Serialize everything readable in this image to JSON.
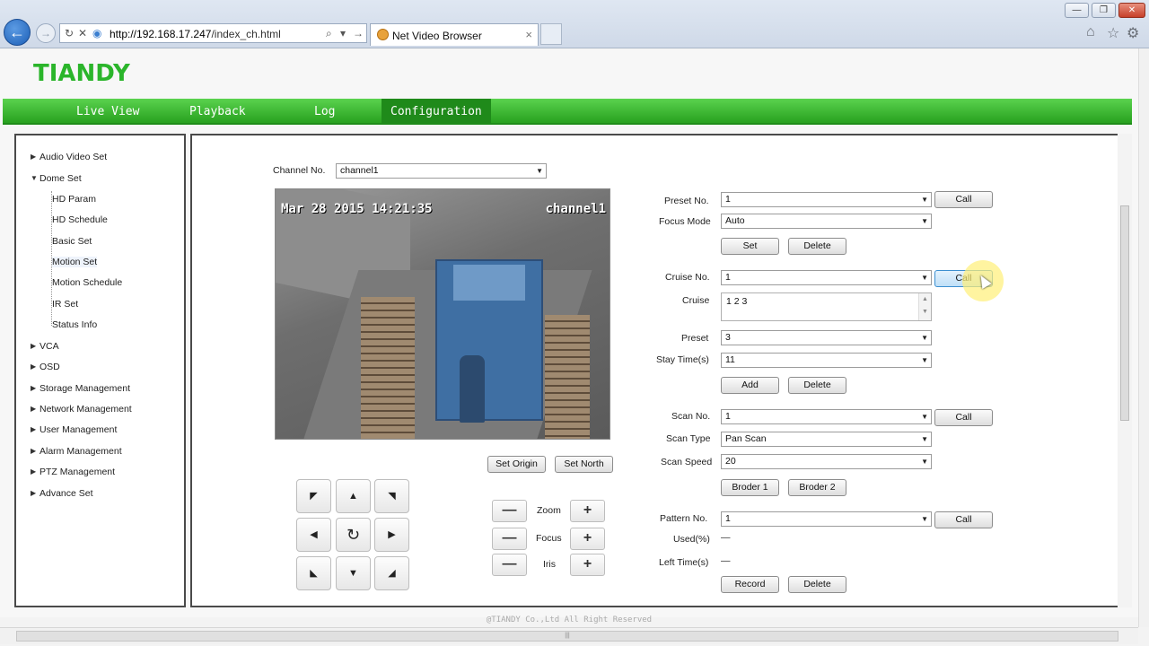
{
  "browser": {
    "url_host": "http://192.168.17.247",
    "url_path": "/index_ch.html",
    "tab_title": "Net Video Browser",
    "tab_close": "×",
    "back_icon": "arrow-left-icon",
    "forward_icon": "arrow-right-icon"
  },
  "app": {
    "logo": "TIANDY",
    "menu": [
      "Live View",
      "Playback",
      "Log",
      "Configuration"
    ],
    "active_menu": "Configuration"
  },
  "sidebar": {
    "items": [
      {
        "label": "Audio Video Set",
        "expanded": false
      },
      {
        "label": "Dome Set",
        "expanded": true
      },
      {
        "label": "HD Param"
      },
      {
        "label": "HD Schedule"
      },
      {
        "label": "Basic Set"
      },
      {
        "label": "Motion Set",
        "selected": true
      },
      {
        "label": "Motion Schedule"
      },
      {
        "label": "IR Set"
      },
      {
        "label": "Status Info"
      },
      {
        "label": "VCA",
        "expanded": false
      },
      {
        "label": "OSD",
        "expanded": false
      },
      {
        "label": "Storage Management",
        "expanded": false
      },
      {
        "label": "Network Management",
        "expanded": false
      },
      {
        "label": "User Management",
        "expanded": false
      },
      {
        "label": "Alarm Management",
        "expanded": false
      },
      {
        "label": "PTZ Management",
        "expanded": false
      },
      {
        "label": "Advance Set",
        "expanded": false
      }
    ]
  },
  "main": {
    "channel_label": "Channel No.",
    "channel_value": "channel1",
    "video": {
      "timestamp": "Mar 28 2015 14:21:35",
      "channel_overlay": "channel1"
    },
    "set_origin": "Set Origin",
    "set_north": "Set North",
    "zoom_label": "Zoom",
    "focus_label": "Focus",
    "iris_label": "Iris",
    "minus": "—",
    "plus": "+",
    "preset": {
      "label": "Preset No.",
      "value": "1",
      "call": "Call",
      "focus_mode_label": "Focus Mode",
      "focus_mode_value": "Auto",
      "set": "Set",
      "delete": "Delete"
    },
    "cruise": {
      "label": "Cruise No.",
      "value": "1",
      "call": "Call",
      "cruise_label": "Cruise",
      "cruise_value": "1 2 3",
      "preset_label": "Preset",
      "preset_value": "3",
      "stay_label": "Stay Time(s)",
      "stay_value": "11",
      "add": "Add",
      "delete": "Delete"
    },
    "scan": {
      "label": "Scan No.",
      "value": "1",
      "call": "Call",
      "type_label": "Scan Type",
      "type_value": "Pan Scan",
      "speed_label": "Scan Speed",
      "speed_value": "20",
      "broder1": "Broder 1",
      "broder2": "Broder 2"
    },
    "pattern": {
      "label": "Pattern No.",
      "value": "1",
      "call": "Call",
      "used_label": "Used(%)",
      "used_value": "—",
      "left_label": "Left Time(s)",
      "left_value": "—",
      "record": "Record",
      "delete": "Delete"
    }
  },
  "footer": "@TIANDY Co.,Ltd All Right Reserved"
}
